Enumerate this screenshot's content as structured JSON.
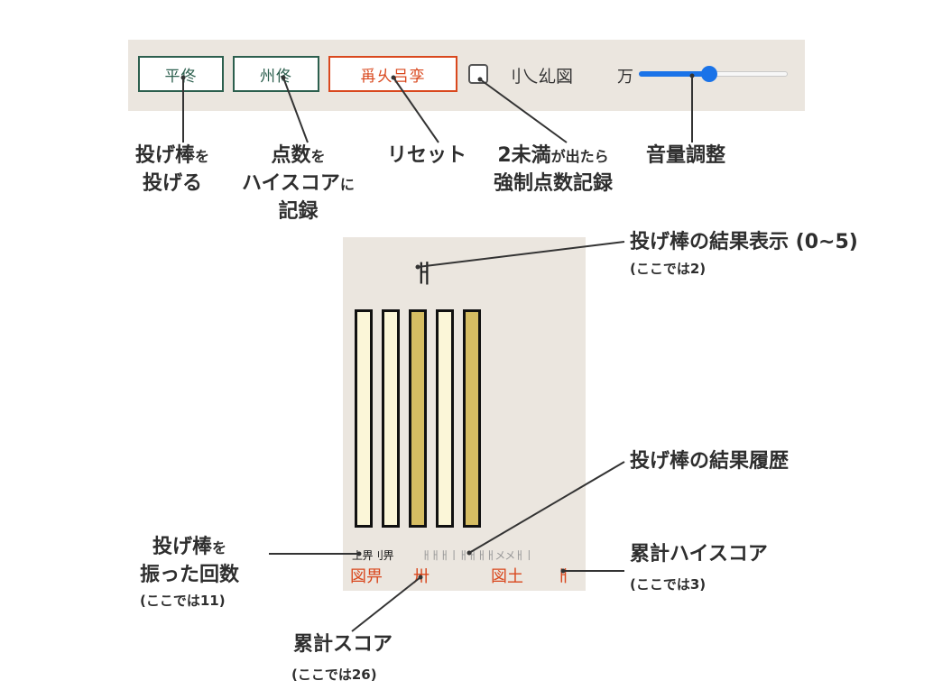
{
  "toolbar": {
    "throw_button": "平佟",
    "record_button": "州佟",
    "reset_button": "爯乆吕孪",
    "checkbox_label": "刂乀乣図",
    "volume_label": "万",
    "volume_level": 0.47,
    "checkbox_checked": false
  },
  "annotations": {
    "throw": {
      "line1": "投げ棒",
      "line1_small": "を",
      "line2": "投げる"
    },
    "record": {
      "line1": "点数",
      "line1_small": "を",
      "line2": "ハイスコア",
      "line2_small": "に",
      "line3": "記録"
    },
    "reset": {
      "line1": "リセット"
    },
    "force": {
      "line1a": "2未満",
      "line1_small": "が出たら",
      "line2": "強制点数記録"
    },
    "volume": {
      "line1": "音量調整"
    },
    "result": {
      "title": "投げ棒の結果表示 (0~5)",
      "sub": "(ここでは2)"
    },
    "history": {
      "title": "投げ棒の結果履歴"
    },
    "count": {
      "line1": "投げ棒",
      "line1_small": "を",
      "line2": "振った回数",
      "sub": "(ここでは11)"
    },
    "high_score": {
      "title": "累計ハイスコア",
      "sub": "(ここでは3)"
    },
    "score": {
      "title": "累計スコア",
      "sub": "(ここでは26)"
    }
  },
  "game": {
    "result_glyph": "ㅐ",
    "sticks": [
      "light",
      "light",
      "dark",
      "light",
      "dark"
    ],
    "count_text": "丄畀刂畀",
    "history_text": "ㅐㅐㅐ丨ㅐㅐㅐㅐメメㅐ丨",
    "score_label": "図畀",
    "score_value": "卅",
    "high_label": "図土",
    "high_value": "ㅐ"
  },
  "colors": {
    "green": "#2c5f4e",
    "red": "#d9481e",
    "panel_bg": "#ebe6df",
    "stick_light": "#fbf6d8",
    "stick_dark": "#d6bd63",
    "slider_blue": "#1a73e8"
  }
}
